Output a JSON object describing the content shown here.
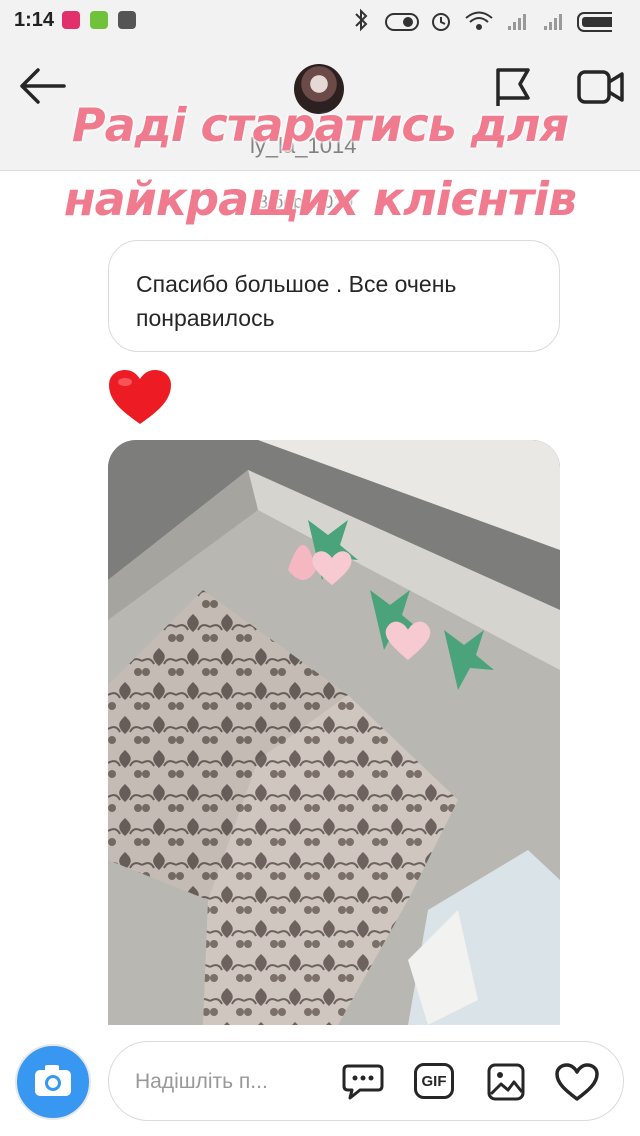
{
  "status_bar": {
    "time": "1:14"
  },
  "header": {
    "username": "ly_la_1014"
  },
  "thread": {
    "date": "8 бер. 2019",
    "message": "Спасибо большое . Все очень понравилось",
    "reaction": "heart-emoji"
  },
  "overlay": {
    "line1": "Раді старатись для",
    "line2": "найкращих клієнтів"
  },
  "composer": {
    "placeholder": "Надішліть п...",
    "gif_label": "GIF"
  },
  "colors": {
    "accent_blue": "#3897f0",
    "overlay_pink": "#f07b8f",
    "heart_red": "#ed1c24"
  }
}
